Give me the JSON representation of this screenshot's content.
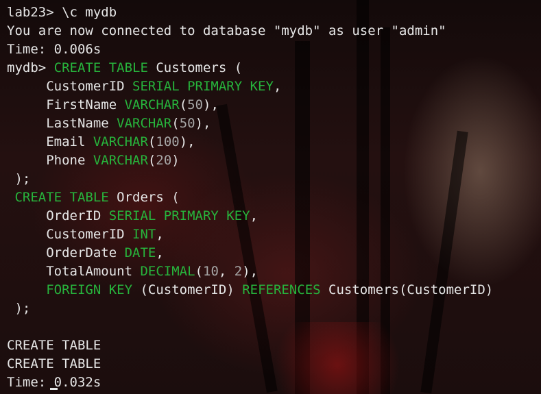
{
  "colors": {
    "keyword": "#27b43c",
    "text": "#e6e6e6",
    "number": "#a7a7a7"
  },
  "terminal": {
    "lines": [
      {
        "segments": [
          {
            "t": "lab23> \\c mydb"
          }
        ]
      },
      {
        "segments": [
          {
            "t": "You are now connected to database \"mydb\" as user \"admin\""
          }
        ]
      },
      {
        "segments": [
          {
            "t": "Time: 0.006s"
          }
        ]
      },
      {
        "segments": [
          {
            "t": "mydb> "
          },
          {
            "t": "CREATE TABLE",
            "k": "kw"
          },
          {
            "t": " Customers ("
          }
        ]
      },
      {
        "segments": [
          {
            "t": "     CustomerID "
          },
          {
            "t": "SERIAL PRIMARY KEY",
            "k": "kw"
          },
          {
            "t": ","
          }
        ]
      },
      {
        "segments": [
          {
            "t": "     FirstName "
          },
          {
            "t": "VARCHAR",
            "k": "kw"
          },
          {
            "t": "("
          },
          {
            "t": "50",
            "k": "num"
          },
          {
            "t": "),"
          }
        ]
      },
      {
        "segments": [
          {
            "t": "     LastName "
          },
          {
            "t": "VARCHAR",
            "k": "kw"
          },
          {
            "t": "("
          },
          {
            "t": "50",
            "k": "num"
          },
          {
            "t": "),"
          }
        ]
      },
      {
        "segments": [
          {
            "t": "     Email "
          },
          {
            "t": "VARCHAR",
            "k": "kw"
          },
          {
            "t": "("
          },
          {
            "t": "100",
            "k": "num"
          },
          {
            "t": "),"
          }
        ]
      },
      {
        "segments": [
          {
            "t": "     Phone "
          },
          {
            "t": "VARCHAR",
            "k": "kw"
          },
          {
            "t": "("
          },
          {
            "t": "20",
            "k": "num"
          },
          {
            "t": ")"
          }
        ]
      },
      {
        "segments": [
          {
            "t": " );"
          }
        ]
      },
      {
        "segments": [
          {
            "t": " "
          },
          {
            "t": "CREATE TABLE",
            "k": "kw"
          },
          {
            "t": " Orders ("
          }
        ]
      },
      {
        "segments": [
          {
            "t": "     OrderID "
          },
          {
            "t": "SERIAL PRIMARY KEY",
            "k": "kw"
          },
          {
            "t": ","
          }
        ]
      },
      {
        "segments": [
          {
            "t": "     CustomerID "
          },
          {
            "t": "INT",
            "k": "kw"
          },
          {
            "t": ","
          }
        ]
      },
      {
        "segments": [
          {
            "t": "     OrderDate "
          },
          {
            "t": "DATE",
            "k": "kw"
          },
          {
            "t": ","
          }
        ]
      },
      {
        "segments": [
          {
            "t": "     TotalAmount "
          },
          {
            "t": "DECIMAL",
            "k": "kw"
          },
          {
            "t": "("
          },
          {
            "t": "10",
            "k": "num"
          },
          {
            "t": ", "
          },
          {
            "t": "2",
            "k": "num"
          },
          {
            "t": "),"
          }
        ]
      },
      {
        "segments": [
          {
            "t": "     "
          },
          {
            "t": "FOREIGN KEY",
            "k": "kw"
          },
          {
            "t": " (CustomerID) "
          },
          {
            "t": "REFERENCES",
            "k": "kw"
          },
          {
            "t": " Customers(CustomerID)"
          }
        ]
      },
      {
        "segments": [
          {
            "t": " );"
          }
        ]
      },
      {
        "segments": [
          {
            "t": ""
          }
        ]
      },
      {
        "segments": [
          {
            "t": "CREATE TABLE"
          }
        ]
      },
      {
        "segments": [
          {
            "t": "CREATE TABLE"
          }
        ]
      },
      {
        "segments": [
          {
            "t": "Time: 0.032s"
          }
        ]
      }
    ]
  }
}
